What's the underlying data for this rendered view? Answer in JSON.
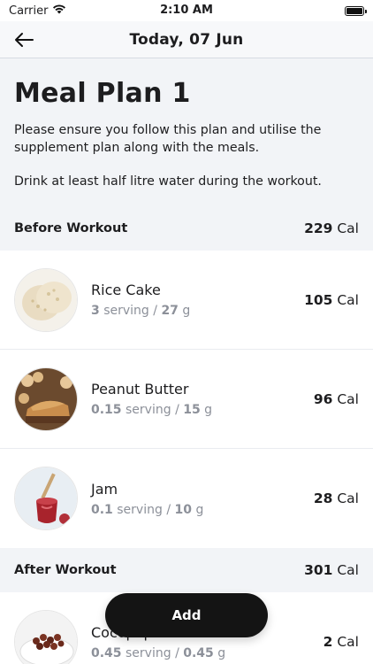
{
  "status": {
    "carrier": "Carrier",
    "time": "2:10 AM"
  },
  "nav": {
    "title": "Today, 07 Jun"
  },
  "plan": {
    "title": "Meal Plan 1",
    "description": "Please ensure you follow this plan and utilise the supplement plan along with the meals.",
    "note": "Drink at least half litre water during the workout."
  },
  "sections": [
    {
      "name": "Before Workout",
      "calories": "229",
      "cal_unit": "Cal",
      "items": [
        {
          "name": "Rice Cake",
          "serving_qty": "3",
          "serving_label": "serving",
          "separator": "/",
          "weight": "27",
          "weight_unit": "g",
          "calories": "105",
          "cal_unit": "Cal",
          "icon": "rice-cake-icon"
        },
        {
          "name": "Peanut Butter",
          "serving_qty": "0.15",
          "serving_label": "serving",
          "separator": "/",
          "weight": "15",
          "weight_unit": "g",
          "calories": "96",
          "cal_unit": "Cal",
          "icon": "peanut-butter-icon"
        },
        {
          "name": "Jam",
          "serving_qty": "0.1",
          "serving_label": "serving",
          "separator": "/",
          "weight": "10",
          "weight_unit": "g",
          "calories": "28",
          "cal_unit": "Cal",
          "icon": "jam-icon"
        }
      ]
    },
    {
      "name": "After Workout",
      "calories": "301",
      "cal_unit": "Cal",
      "items": [
        {
          "name": "Cocopops",
          "serving_qty": "0.45",
          "serving_label": "serving",
          "separator": "/",
          "weight": "0.45",
          "weight_unit": "g",
          "calories": "2",
          "cal_unit": "Cal",
          "icon": "cocopops-icon"
        }
      ]
    }
  ],
  "actions": {
    "add_label": "Add"
  },
  "colors": {
    "primary_text": "#1d1d1f",
    "secondary_text": "#8c9099",
    "background": "#f2f4f7",
    "button": "#141414"
  }
}
